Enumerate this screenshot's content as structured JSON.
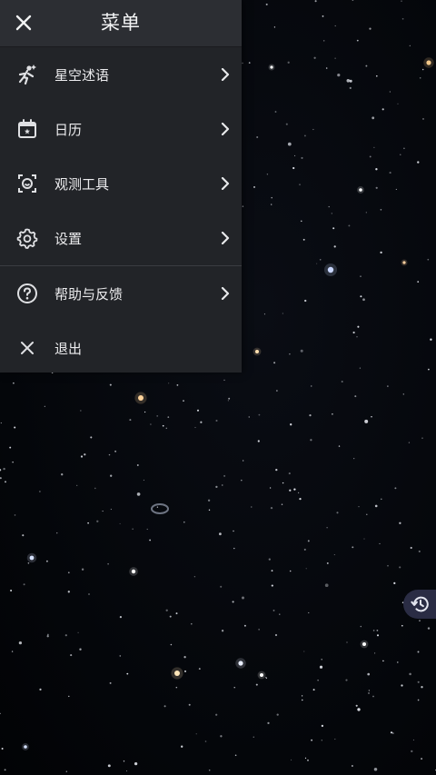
{
  "menu": {
    "title": "菜单",
    "items": [
      {
        "label": "星空述语",
        "icon": "astronaut-running-icon"
      },
      {
        "label": "日历",
        "icon": "calendar-icon"
      },
      {
        "label": "观测工具",
        "icon": "camera-scan-icon"
      },
      {
        "label": "设置",
        "icon": "gear-icon"
      },
      {
        "label": "帮助与反馈",
        "icon": "help-circle-icon"
      },
      {
        "label": "退出",
        "icon": "close-icon"
      }
    ]
  },
  "colors": {
    "menu_bg": "#222428",
    "header_bg": "#2c2e33",
    "history_button_bg": "#2a2c44",
    "sky_bg": "#05070b"
  }
}
